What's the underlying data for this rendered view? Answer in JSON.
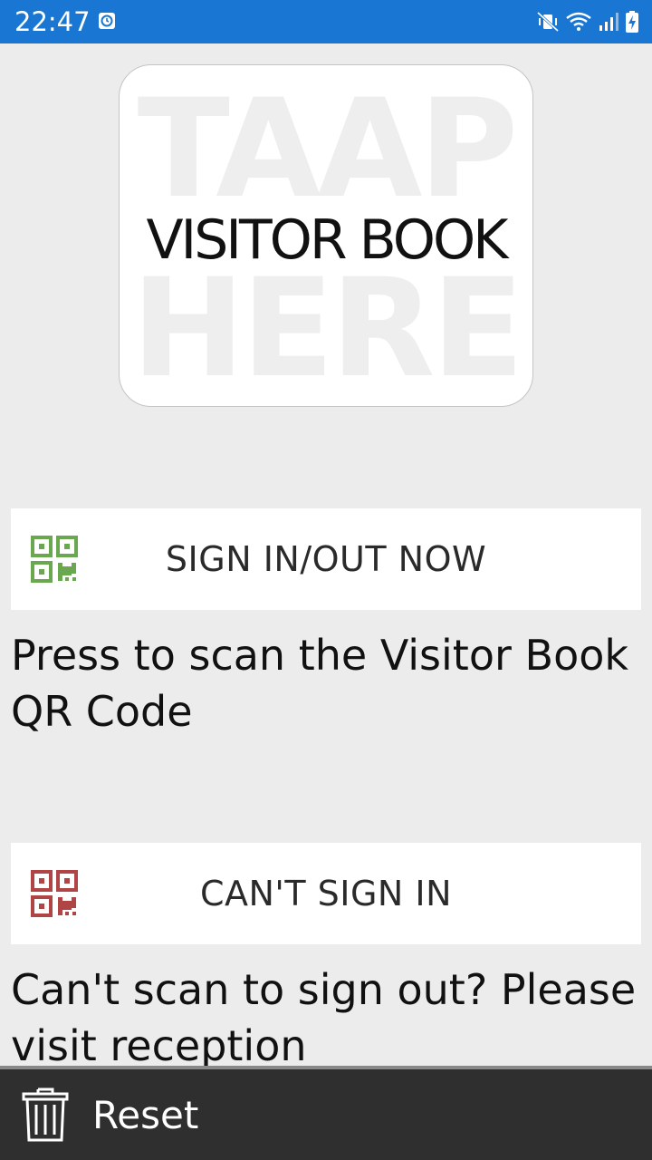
{
  "status_bar": {
    "time": "22:47",
    "background": "#1976d2"
  },
  "logo": {
    "watermark_top": "TAAP",
    "main_text": "VISITOR BOOK",
    "watermark_bottom": "HERE"
  },
  "sign_in": {
    "button_label": "SIGN IN/OUT NOW",
    "icon": "qr-code-icon",
    "icon_color": "#6aa84f",
    "description": "Press to scan the Visitor Book QR Code"
  },
  "cant_sign_in": {
    "button_label": "CAN'T SIGN IN",
    "icon": "qr-code-icon",
    "icon_color": "#b04545",
    "description": "Can't scan to sign out? Please visit reception"
  },
  "bottom_bar": {
    "reset_label": "Reset",
    "reset_icon": "trash-icon"
  }
}
